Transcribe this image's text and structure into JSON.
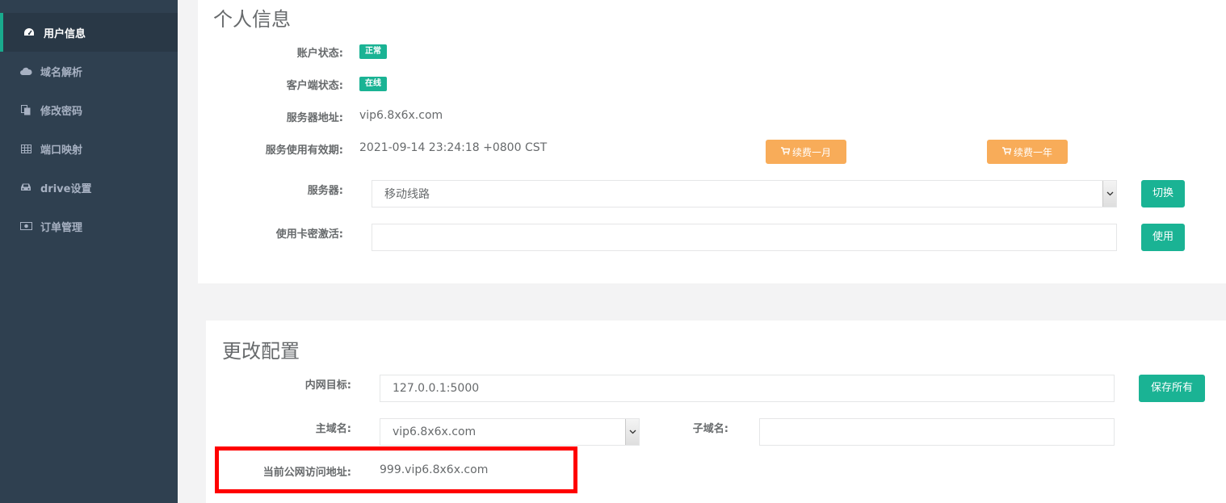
{
  "sidebar": {
    "items": [
      {
        "label": "用户信息",
        "icon": "dashboard-icon"
      },
      {
        "label": "域名解析",
        "icon": "cloud-icon"
      },
      {
        "label": "修改密码",
        "icon": "files-icon"
      },
      {
        "label": "端口映射",
        "icon": "table-icon"
      },
      {
        "label": "drive设置",
        "icon": "car-icon"
      },
      {
        "label": "订单管理",
        "icon": "money-icon"
      }
    ]
  },
  "profile": {
    "title": "个人信息",
    "account_status_label": "账户状态:",
    "account_status": "正常",
    "client_status_label": "客户端状态:",
    "client_status": "在线",
    "server_address_label": "服务器地址:",
    "server_address": "vip6.8x6x.com",
    "expiry_label": "服务使用有效期:",
    "expiry": "2021-09-14 23:24:18 +0800 CST",
    "renew_month": "续费一月",
    "renew_year": "续费一年",
    "server_label": "服务器:",
    "server_selected": "移动线路",
    "switch_button": "切换",
    "card_label": "使用卡密激活:",
    "card_value": "",
    "use_button": "使用"
  },
  "config": {
    "title": "更改配置",
    "target_label": "内网目标:",
    "target_value": "127.0.0.1:5000",
    "save_button": "保存所有",
    "domain_label": "主域名:",
    "domain_selected": "vip6.8x6x.com",
    "subdomain_label": "子域名:",
    "subdomain_value": "",
    "public_address_label": "当前公网访问地址:",
    "public_address": "999.vip6.8x6x.com"
  },
  "colors": {
    "sidebar_bg": "#2f4050",
    "primary": "#1ab394",
    "warning": "#f8ac59",
    "highlight": "#ff0000"
  }
}
